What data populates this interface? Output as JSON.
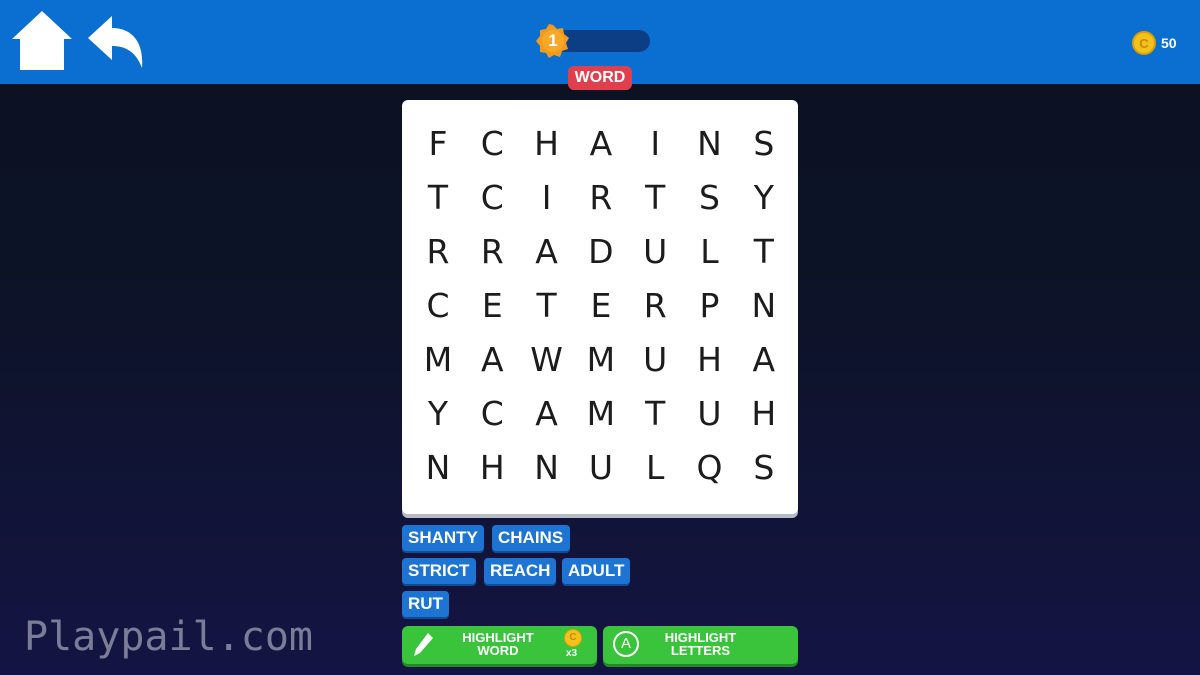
{
  "header": {
    "level": "1",
    "coin_count": "50",
    "coin_symbol": "C"
  },
  "mode_label": "WORD",
  "grid": [
    [
      "F",
      "C",
      "H",
      "A",
      "I",
      "N",
      "S"
    ],
    [
      "T",
      "C",
      "I",
      "R",
      "T",
      "S",
      "Y"
    ],
    [
      "R",
      "R",
      "A",
      "D",
      "U",
      "L",
      "T"
    ],
    [
      "C",
      "E",
      "T",
      "E",
      "R",
      "P",
      "N"
    ],
    [
      "M",
      "A",
      "W",
      "M",
      "U",
      "H",
      "A"
    ],
    [
      "Y",
      "C",
      "A",
      "M",
      "T",
      "U",
      "H"
    ],
    [
      "N",
      "H",
      "N",
      "U",
      "L",
      "Q",
      "S"
    ]
  ],
  "words": [
    "SHANTY",
    "CHAINS",
    "STRICT",
    "REACH",
    "ADULT",
    "RUT"
  ],
  "hints": {
    "highlight_word": "HIGHLIGHT\nWORD",
    "highlight_word_cost": "x3",
    "highlight_word_coin": "C",
    "highlight_letters": "HIGHLIGHT\nLETTERS",
    "letters_icon": "A"
  },
  "watermark": "Playpail.com",
  "colors": {
    "topbar": "#0a6fd0",
    "word_chip": "#1e74d2",
    "hint_button": "#39c43c",
    "mode_badge": "#e0404e",
    "coin": "#f2c21b"
  },
  "icons": [
    "home-icon",
    "back-arrow-icon",
    "level-badge-icon",
    "coin-icon",
    "pencil-icon",
    "letter-circle-icon"
  ]
}
